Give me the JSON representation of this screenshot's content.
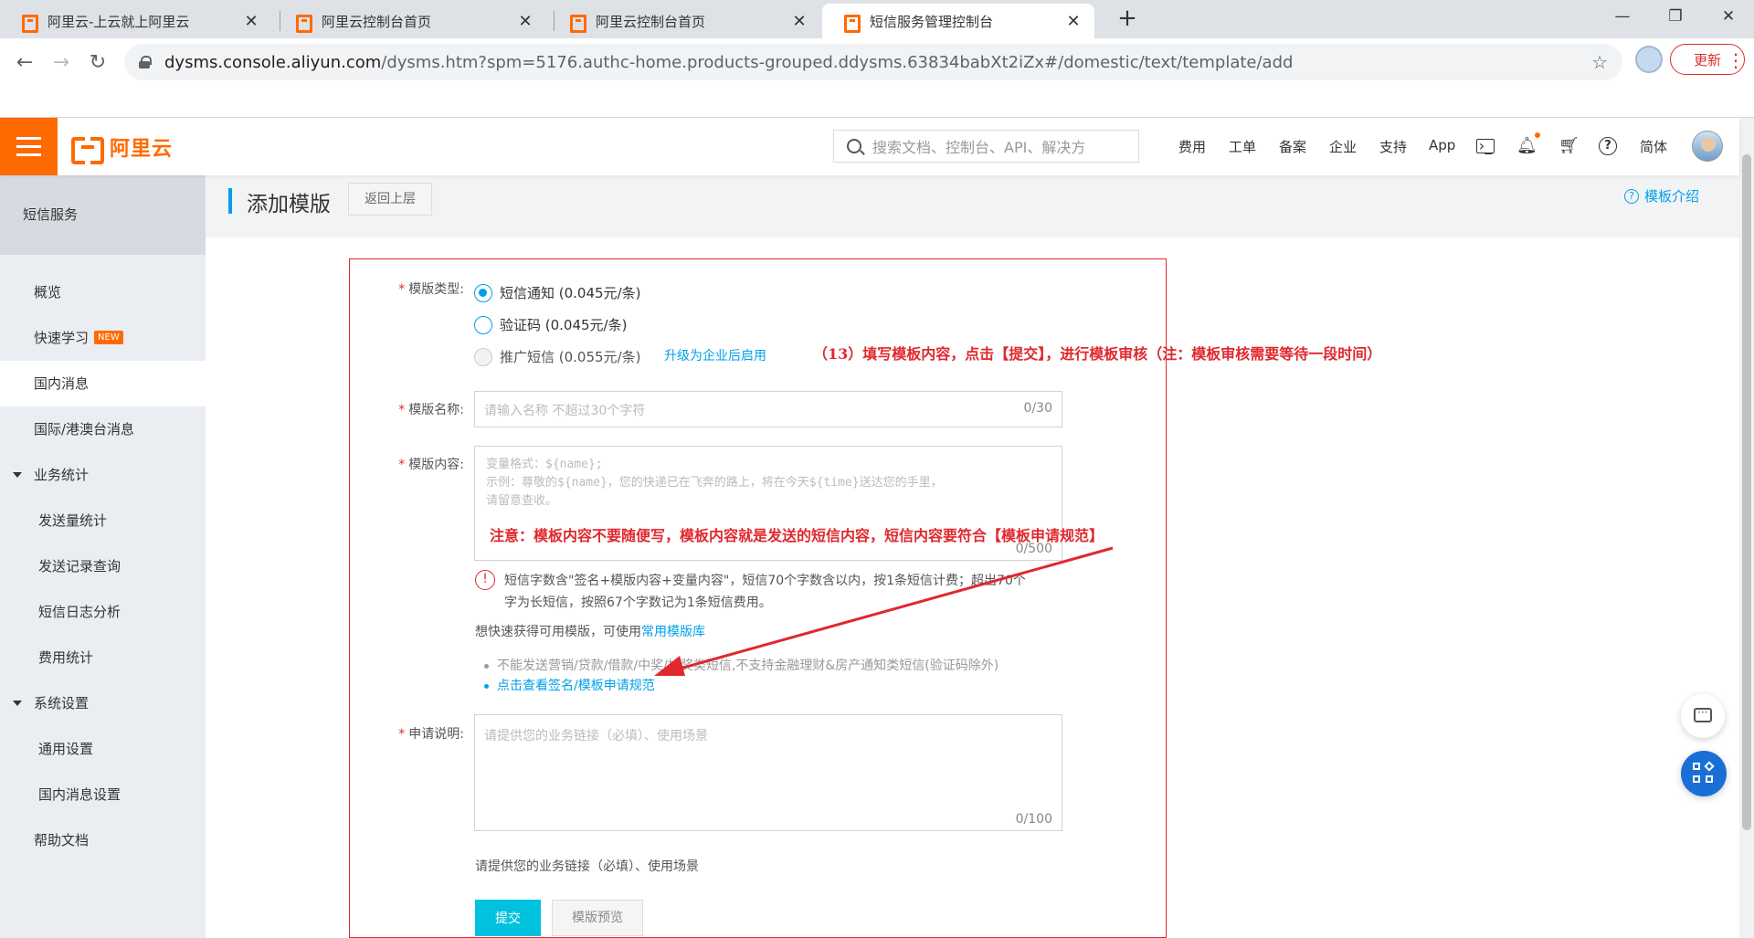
{
  "browser": {
    "tabs": [
      {
        "title": "阿里云-上云就上阿里云",
        "active": false
      },
      {
        "title": "阿里云控制台首页",
        "active": false
      },
      {
        "title": "阿里云控制台首页",
        "active": false
      },
      {
        "title": "短信服务管理控制台",
        "active": true
      }
    ],
    "url_host": "dysms.console.aliyun.com",
    "url_rest": "/dysms.htm?spm=5176.authc-home.products-grouped.ddysms.63834babXt2iZx#/domestic/text/template/add",
    "update_label": "更新",
    "window_controls": [
      "minimize-icon",
      "restore-icon",
      "close-icon"
    ]
  },
  "header": {
    "logo_text": "阿里云",
    "search_placeholder": "搜索文档、控制台、API、解决方",
    "nav": [
      "费用",
      "工单",
      "备案",
      "企业",
      "支持",
      "App"
    ],
    "lang": "简体",
    "icons": [
      "terminal-icon",
      "bell-icon",
      "cart-icon",
      "help-icon"
    ]
  },
  "sidebar": {
    "title": "短信服务",
    "items": [
      {
        "label": "概览",
        "type": "item"
      },
      {
        "label": "快速学习",
        "type": "item",
        "badge": "NEW"
      },
      {
        "label": "国内消息",
        "type": "item",
        "active": true
      },
      {
        "label": "国际/港澳台消息",
        "type": "item"
      },
      {
        "label": "业务统计",
        "type": "group"
      },
      {
        "label": "发送量统计",
        "type": "sub"
      },
      {
        "label": "发送记录查询",
        "type": "sub"
      },
      {
        "label": "短信日志分析",
        "type": "sub"
      },
      {
        "label": "费用统计",
        "type": "sub"
      },
      {
        "label": "系统设置",
        "type": "group"
      },
      {
        "label": "通用设置",
        "type": "sub"
      },
      {
        "label": "国内消息设置",
        "type": "sub"
      },
      {
        "label": "帮助文档",
        "type": "item"
      }
    ]
  },
  "page": {
    "title": "添加模版",
    "back_label": "返回上层",
    "intro_label": "模板介绍"
  },
  "form": {
    "type_label": "模版类型:",
    "type_options": [
      {
        "label": "短信通知 (0.045元/条)",
        "checked": true,
        "disabled": false
      },
      {
        "label": "验证码 (0.045元/条)",
        "checked": false,
        "disabled": false
      },
      {
        "label": "推广短信 (0.055元/条)",
        "checked": false,
        "disabled": true
      }
    ],
    "upgrade_link": "升级为企业后启用",
    "name_label": "模版名称:",
    "name_placeholder": "请输入名称 不超过30个字符",
    "name_counter": "0/30",
    "content_label": "模版内容:",
    "content_placeholder_lines": [
      "变量格式：${name};",
      " 示例：尊敬的${name}，您的快递已在飞奔的路上，将在今天${time}送达您的手里，",
      "请留意查收。"
    ],
    "content_counter": "0/500",
    "warning_lines": [
      "短信字数含\"签名+模版内容+变量内容\"，短信70个字数含以内，按1条短信计费；超出70个",
      "字为长短信，按照67个字数记为1条短信费用。"
    ],
    "hint_text": "想快速获得可用模版，可使用",
    "hint_link": "常用模版库",
    "bullets": [
      {
        "text": "不能发送营销/贷款/借款/中奖/抽奖类短信,不支持金融理财&房产通知类短信(验证码除外)",
        "link": false
      },
      {
        "text": "点击查看签名/模板申请规范",
        "link": true
      }
    ],
    "desc_label": "申请说明:",
    "desc_placeholder": "请提供您的业务链接（必填）、使用场景",
    "desc_counter": "0/100",
    "under_note": "请提供您的业务链接（必填）、使用场景",
    "submit_label": "提交",
    "preview_label": "模版预览"
  },
  "annotations": {
    "step13": "（13）填写模板内容，点击【提交】，进行模板审核（注：模板审核需要等待一段时间）",
    "note": "注意：模板内容不要随便写，模板内容就是发送的短信内容，短信内容要符合【模板申请规范】"
  },
  "colors": {
    "brand": "#ff6a00",
    "accent": "#00a0e9",
    "submit": "#00c1de",
    "annotation": "#e0282e"
  }
}
